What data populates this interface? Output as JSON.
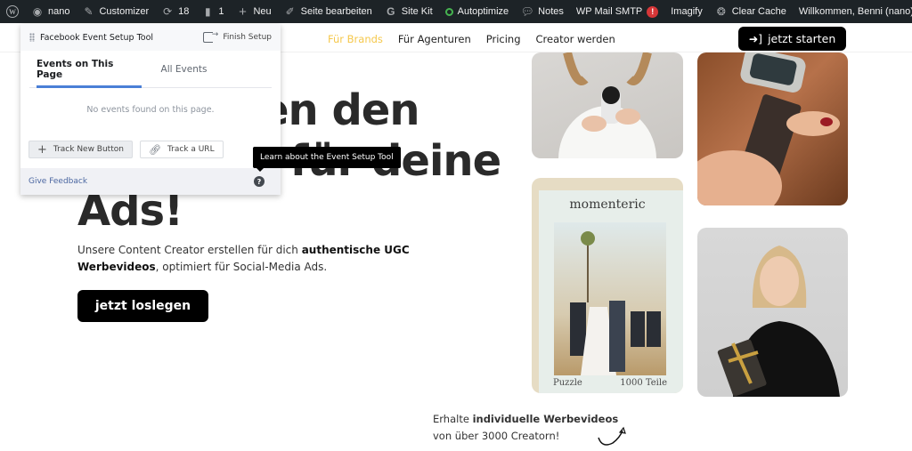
{
  "adminbar": {
    "site_name": "nano",
    "customizer": "Customizer",
    "updates_count": "18",
    "comments_count": "1",
    "new_label": "Neu",
    "edit_page": "Seite bearbeiten",
    "site_kit": "Site Kit",
    "autoptimize": "Autoptimize",
    "notes": "Notes",
    "wp_mail_smtp": "WP Mail SMTP",
    "wp_mail_badge": "!",
    "imagify": "Imagify",
    "clear_cache": "Clear Cache",
    "greeting": "Willkommen, Benni (nano)"
  },
  "site_nav": {
    "items": [
      {
        "label": "Für Brands",
        "active": true
      },
      {
        "label": "Für Agenturen"
      },
      {
        "label": "Pricing"
      },
      {
        "label": "Creator werden"
      }
    ],
    "cta": "jetzt starten",
    "accent_color": "#f5c84c"
  },
  "hero": {
    "line1_visible": "en den",
    "line2_visible": "f für deine",
    "line3": "Ads!",
    "sub_prefix": "Unsere Content Creator erstellen für dich ",
    "sub_bold": "authentische UGC Werbevideos",
    "sub_suffix": ", optimiert für Social-Media Ads.",
    "cta": "jetzt loslegen"
  },
  "gallery": {
    "puzzle_brand": "momenteric",
    "puzzle_label_left": "Puzzle",
    "puzzle_label_right": "1000 Teile"
  },
  "bottom": {
    "prefix": "Erhalte ",
    "bold": "individuelle Werbevideos",
    "line2": "von über 3000 Creatorn!"
  },
  "fb_tool": {
    "title": "Facebook Event Setup Tool",
    "finish_setup": "Finish Setup",
    "tabs": [
      {
        "label": "Events on This Page",
        "active": true
      },
      {
        "label": "All Events"
      }
    ],
    "empty_message": "No events found on this page.",
    "track_new_button": "Track New Button",
    "track_url": "Track a URL",
    "give_feedback": "Give Feedback",
    "tooltip": "Learn about the Event Setup Tool",
    "tab_accent": "#4a7fd6"
  }
}
